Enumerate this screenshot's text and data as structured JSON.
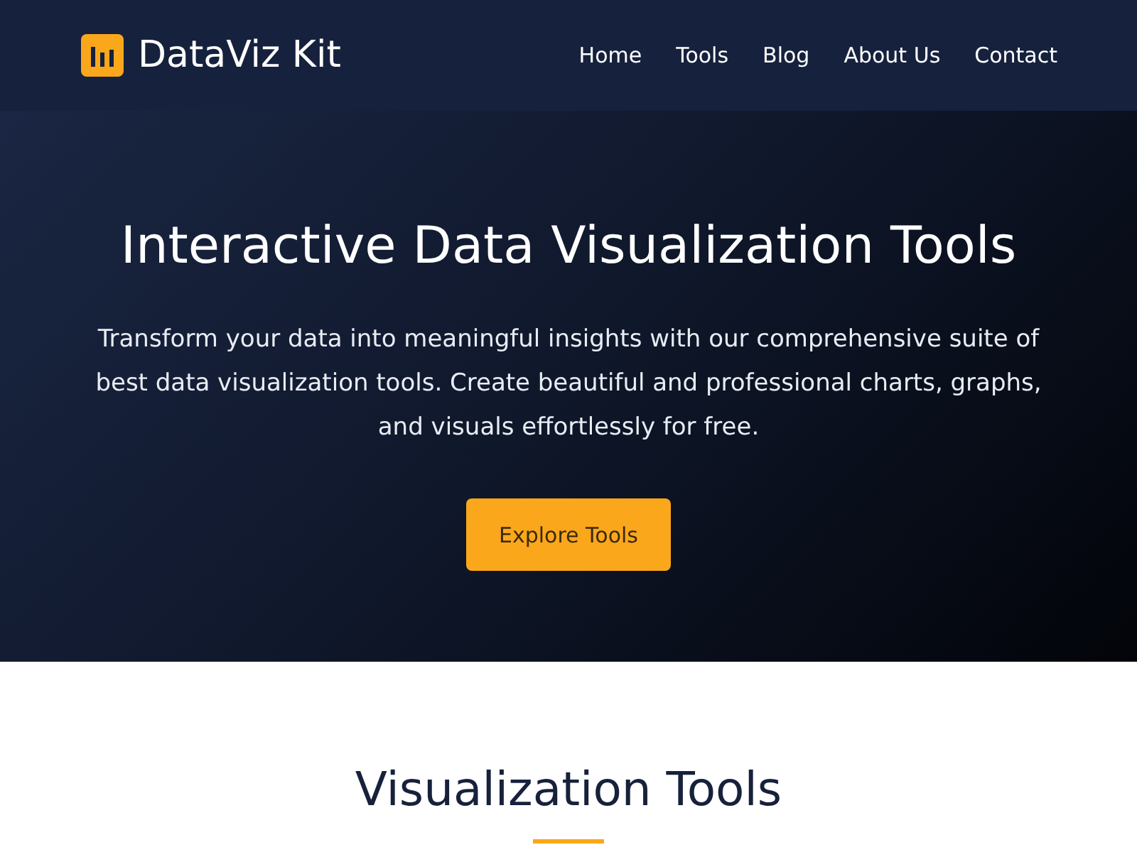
{
  "brand": "DataViz Kit",
  "nav": [
    {
      "label": "Home"
    },
    {
      "label": "Tools"
    },
    {
      "label": "Blog"
    },
    {
      "label": "About Us"
    },
    {
      "label": "Contact"
    }
  ],
  "hero": {
    "title": "Interactive Data Visualization Tools",
    "text": "Transform your data into meaningful insights with our comprehensive suite of best data visualization tools. Create beautiful and professional charts, graphs, and visuals effortlessly for free.",
    "button": "Explore Tools"
  },
  "section": {
    "title": "Visualization Tools"
  }
}
